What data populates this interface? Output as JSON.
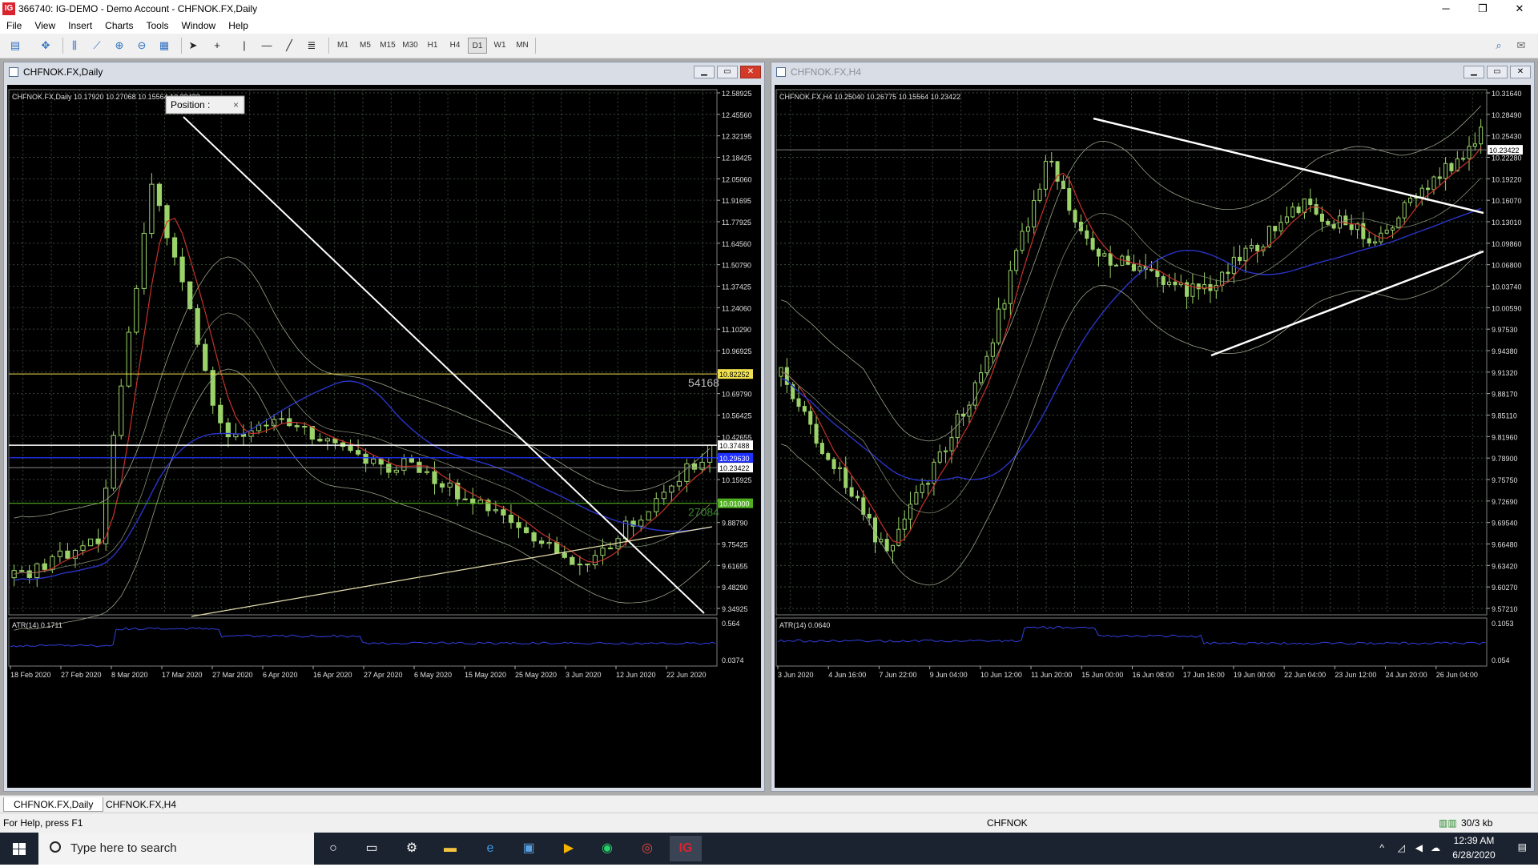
{
  "window": {
    "title": "366740: IG-DEMO - Demo Account - CHFNOK.FX,Daily",
    "app_icon": "IG",
    "minimize": "─",
    "maximize": "❐",
    "close": "✕"
  },
  "menu": [
    "File",
    "View",
    "Insert",
    "Charts",
    "Tools",
    "Window",
    "Help"
  ],
  "toolbar": {
    "timeframes": [
      "M1",
      "M5",
      "M15",
      "M30",
      "H1",
      "H4",
      "D1",
      "W1",
      "MN"
    ],
    "active_timeframe": "D1"
  },
  "daily": {
    "title": "CHFNOK.FX,Daily",
    "header": "CHFNOK.FX,Daily  10.17920 10.27068 10.15564 10.23422",
    "position_popup": "Position :",
    "price_labels": [
      "12.58925",
      "12.45560",
      "12.32195",
      "12.18425",
      "12.05060",
      "11.91695",
      "11.77925",
      "11.64560",
      "11.50790",
      "11.37425",
      "11.24060",
      "11.10290",
      "10.96925",
      "10.83560",
      "10.69790",
      "10.56425",
      "10.42655",
      "10.29290",
      "10.15925",
      "10.02560",
      "9.88790",
      "9.75425",
      "9.61655",
      "9.48290",
      "9.34925"
    ],
    "tags": {
      "yellow": "10.82252",
      "white": "10.37488",
      "blue": "10.29630",
      "current": "10.23422",
      "green": "10.01000"
    },
    "line_labels": {
      "upper": "54168",
      "lower": "27084"
    },
    "atr_label": "ATR(14) 0.1711",
    "atr_scale": [
      "0.564",
      "0.0374"
    ],
    "dates": [
      "18 Feb 2020",
      "27 Feb 2020",
      "8 Mar 2020",
      "17 Mar 2020",
      "27 Mar 2020",
      "6 Apr 2020",
      "16 Apr 2020",
      "27 Apr 2020",
      "6 May 2020",
      "15 May 2020",
      "25 May 2020",
      "3 Jun 2020",
      "12 Jun 2020",
      "22 Jun 2020"
    ]
  },
  "h4": {
    "title": "CHFNOK.FX,H4",
    "header": "CHFNOK.FX,H4  10.25040 10.26775 10.15564 10.23422",
    "price_labels": [
      "10.31640",
      "10.28490",
      "10.25430",
      "10.22280",
      "10.19220",
      "10.16070",
      "10.13010",
      "10.09860",
      "10.06800",
      "10.03740",
      "10.00590",
      "9.97530",
      "9.94380",
      "9.91320",
      "9.88170",
      "9.85110",
      "9.81960",
      "9.78900",
      "9.75750",
      "9.72690",
      "9.69540",
      "9.66480",
      "9.63420",
      "9.60270",
      "9.57210"
    ],
    "current_tag": "10.23422",
    "atr_label": "ATR(14) 0.0640",
    "atr_scale": [
      "0.1053",
      "0.054"
    ],
    "dates": [
      "3 Jun 2020",
      "4 Jun 16:00",
      "7 Jun 22:00",
      "9 Jun 04:00",
      "10 Jun 12:00",
      "11 Jun 20:00",
      "15 Jun 00:00",
      "16 Jun 08:00",
      "17 Jun 16:00",
      "19 Jun 00:00",
      "22 Jun 04:00",
      "23 Jun 12:00",
      "24 Jun 20:00",
      "26 Jun 04:00"
    ]
  },
  "tabs": [
    "CHFNOK.FX,Daily",
    "CHFNOK.FX,H4"
  ],
  "status": {
    "help": "For Help, press F1",
    "symbol": "CHFNOK",
    "traffic": "30/3 kb"
  },
  "taskbar": {
    "search_placeholder": "Type here to search",
    "time": "12:39 AM",
    "date": "6/28/2020"
  },
  "colors": {
    "bull": "#9bd36a",
    "bear": "#9bd36a",
    "grid": "#3a4a3a",
    "ma_red": "#c8322a",
    "ma_blue": "#2a34c8",
    "band": "#9aa48a",
    "yellow": "#f0e050",
    "green_line": "#4fb020",
    "blue_line": "#2030ff"
  }
}
